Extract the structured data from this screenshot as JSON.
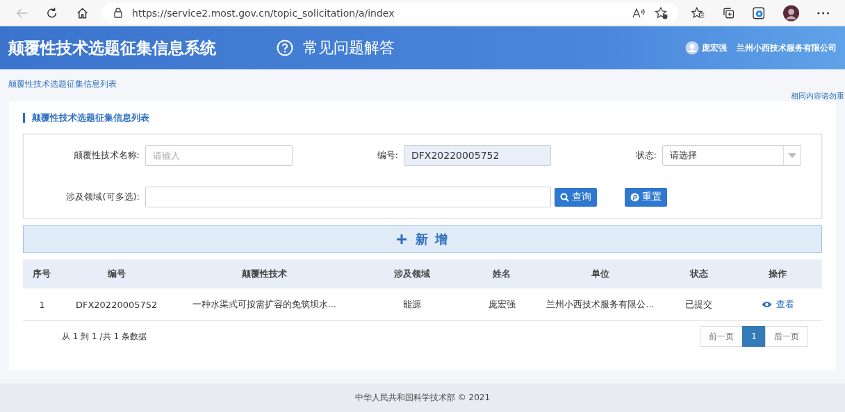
{
  "browser": {
    "url": "https://service2.most.gov.cn/topic_solicitation/a/index"
  },
  "header": {
    "title": "颠覆性技术选题征集信息系统",
    "faq": "常见问题解答",
    "user": "庞宏强",
    "org": "兰州小西技术服务有限公司"
  },
  "breadcrumb": "颠覆性技术选题征集信息列表",
  "notice": "相同内容请勿重",
  "section_title": "颠覆性技术选题征集信息列表",
  "filters": [
    {
      "kind": "text",
      "label": "颠覆性技术名称:",
      "placeholder": "请输入"
    },
    {
      "kind": "filled",
      "label": "编号:",
      "value": "DFX20220005752"
    },
    {
      "kind": "select",
      "label": "状态:",
      "value": "请选择"
    },
    {
      "kind": "wide",
      "label": "涉及领域(可多选):"
    }
  ],
  "search_button": "查询",
  "reset_button": "重置",
  "add_button": "新 增",
  "table": {
    "columns": [
      "序号",
      "编号",
      "颠覆性技术",
      "涉及领域",
      "姓名",
      "单位",
      "状态",
      "操作"
    ],
    "rows": [
      {
        "cells": [
          "1",
          "DFX20220005752",
          "一种水渠式可按需扩容的免筑坝水...",
          "能源",
          "庞宏强",
          "兰州小西技术服务有限公...",
          "已提交"
        ],
        "action": "查看"
      }
    ]
  },
  "summary": "从 1 到 1 /共 1 条数据",
  "pagination": {
    "prev": "前一页",
    "pages": [
      {
        "label": "1",
        "selected": true
      }
    ],
    "next": "后一页"
  },
  "footer": "中华人民共和国科学技术部 © 2021"
}
